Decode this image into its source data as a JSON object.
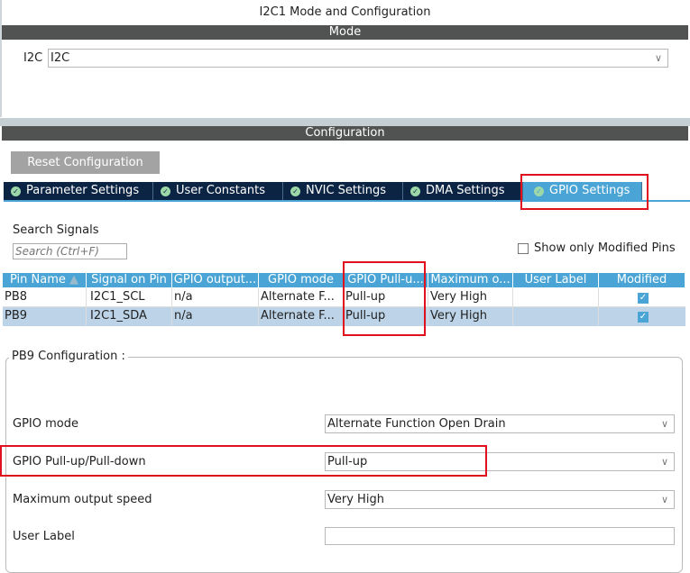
{
  "title": "I2C1 Mode and Configuration",
  "mode": {
    "header": "Mode",
    "label": "I2C",
    "value": "I2C"
  },
  "config": {
    "header": "Configuration",
    "reset_label": "Reset Configuration"
  },
  "tabs": [
    {
      "label": "Parameter Settings"
    },
    {
      "label": "User Constants"
    },
    {
      "label": "NVIC Settings"
    },
    {
      "label": "DMA Settings"
    },
    {
      "label": "GPIO Settings",
      "active": true
    }
  ],
  "search": {
    "label": "Search Signals",
    "placeholder": "Search (Ctrl+F)",
    "show_modified_label": "Show only Modified Pins",
    "show_modified_checked": false
  },
  "table": {
    "columns": [
      "Pin Name",
      "Signal on Pin",
      "GPIO output...",
      "GPIO mode",
      "GPIO Pull-u...",
      "Maximum o...",
      "User Label",
      "Modified"
    ],
    "rows": [
      {
        "pin": "PB8",
        "signal": "I2C1_SCL",
        "output": "n/a",
        "mode": "Alternate F...",
        "pull": "Pull-up",
        "speed": "Very High",
        "user_label": "",
        "modified": true
      },
      {
        "pin": "PB9",
        "signal": "I2C1_SDA",
        "output": "n/a",
        "mode": "Alternate F...",
        "pull": "Pull-up",
        "speed": "Very High",
        "user_label": "",
        "modified": true,
        "selected": true
      }
    ]
  },
  "pin_config": {
    "title": "PB9 Configuration :",
    "fields": [
      {
        "label": "GPIO mode",
        "value": "Alternate Function Open Drain"
      },
      {
        "label": "GPIO Pull-up/Pull-down",
        "value": "Pull-up"
      },
      {
        "label": "Maximum output speed",
        "value": "Very High"
      },
      {
        "label": "User Label",
        "value": ""
      }
    ]
  },
  "colors": {
    "header_bar": "#515352",
    "tab_bg": "#0c2443",
    "tab_active": "#4aa5d6",
    "selected_row": "#bcd3e8",
    "highlight": "#e0101c"
  }
}
